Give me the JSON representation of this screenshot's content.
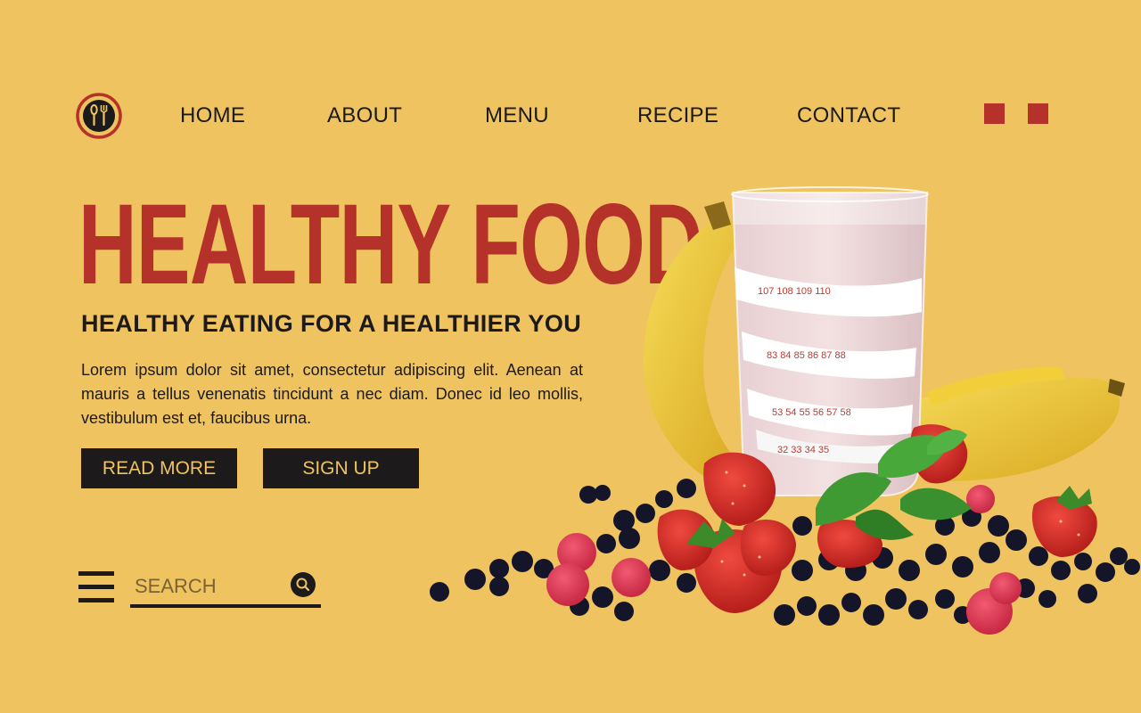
{
  "nav": {
    "items": [
      {
        "label": "HOME"
      },
      {
        "label": "ABOUT"
      },
      {
        "label": "MENU"
      },
      {
        "label": "RECIPE"
      },
      {
        "label": "CONTACT"
      }
    ]
  },
  "hero": {
    "title": "HEALTHY FOOD",
    "subtitle": "HEALTHY EATING FOR A HEALTHIER YOU",
    "description": "Lorem ipsum dolor sit amet, consectetur adipiscing elit. Aenean at mauris a tellus venenatis tincidunt a nec diam. Donec id leo mollis, vestibulum est et, faucibus urna.",
    "read_more_label": "READ MORE",
    "sign_up_label": "SIGN UP"
  },
  "search": {
    "placeholder": "SEARCH"
  },
  "icons": {
    "logo": "fork-spoon-logo-icon",
    "menu": "hamburger-menu-icon",
    "search": "search-icon"
  },
  "colors": {
    "background": "#efc35f",
    "accent": "#b4322a",
    "dark": "#1c1a1a"
  }
}
